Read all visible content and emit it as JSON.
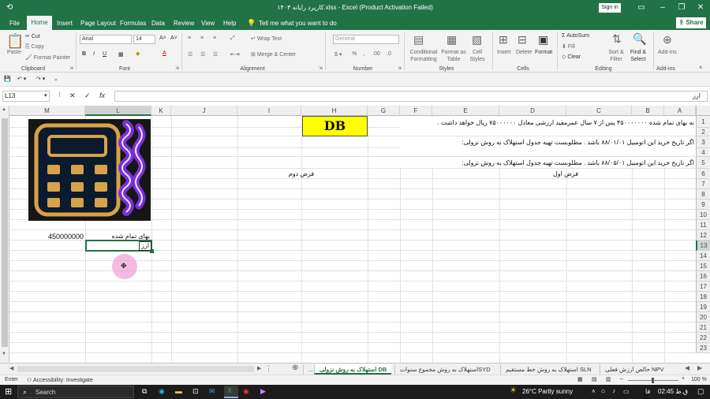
{
  "window": {
    "title": "کارپرد رایانه ۱۴۰۴.xlsx  -  Excel (Product Activation Failed)",
    "sign_in": "Sign in"
  },
  "ribbon_tabs": [
    "File",
    "Home",
    "Insert",
    "Page Layout",
    "Formulas",
    "Data",
    "Review",
    "View",
    "Help"
  ],
  "tell_me": "Tell me what you want to do",
  "share": "Share",
  "ribbon": {
    "clipboard": {
      "paste": "Paste",
      "cut": "Cut",
      "copy": "Copy",
      "format_painter": "Format Painter",
      "label": "Clipboard"
    },
    "font": {
      "name": "Arial",
      "size": "14",
      "label": "Font"
    },
    "alignment": {
      "wrap_text": "Wrap Text",
      "merge_center": "Merge & Center",
      "label": "Alignment"
    },
    "number": {
      "format": "General",
      "label": "Number"
    },
    "styles": {
      "conditional": "Conditional Formatting",
      "format_table": "Format as Table",
      "cell_styles": "Cell Styles",
      "label": "Styles"
    },
    "cells": {
      "insert": "Insert",
      "delete": "Delete",
      "format": "Format",
      "label": "Cells"
    },
    "editing": {
      "autosum": "AutoSum",
      "fill": "Fill",
      "clear": "Clear",
      "sort_filter": "Sort & Filter",
      "find_select": "Find & Select",
      "label": "Editing"
    },
    "addins": {
      "addins": "Add-ins",
      "label": "Add-ins"
    }
  },
  "formula_bar": {
    "name_box": "L13",
    "content": "ارز"
  },
  "columns": [
    "M",
    "L",
    "K",
    "J",
    "I",
    "H",
    "G",
    "F",
    "E",
    "D",
    "C",
    "B",
    "A"
  ],
  "rows": [
    "1",
    "2",
    "3",
    "4",
    "5",
    "6",
    "7",
    "8",
    "9",
    "10",
    "11",
    "12",
    "13",
    "14",
    "15",
    "16",
    "17",
    "18",
    "19",
    "20",
    "21",
    "22",
    "23"
  ],
  "cells": {
    "db_label": "DB",
    "row1": "به بهای تمام شده ۴۵۰۰۰۰۰۰۰ پس از ۷ سال عمرمفید ارزشی معادل ۷۵۰۰۰۰۰۰ ریال خواهد داشت .",
    "row3": "اگر تاریخ خرید این اتومبیل ۸۸/۰۱/۰۱ باشد . مطلوبست تهیه جدول استهلاک به روش نزولی:",
    "row5": "اگر تاریخ خرید این اتومبیل ۸۸/۰۵/۰۱ باشد . مطلوبست تهیه جدول استهلاک به روش نزولی:",
    "first_assumption": "فرض اول",
    "second_assumption": "فرض دوم",
    "cost_label": "بهای تمام شده",
    "cost_value": "450000000",
    "currency_label": "ارز"
  },
  "sheet_tabs": [
    "حالص ارزش فعلی NPV",
    "استهلاک به روش خط مستقیم SLN",
    "استهلاک به روش مجموع سنواتSYD",
    "استهلاک به روش نزولی DB",
    "..."
  ],
  "status": {
    "mode": "Enter",
    "accessibility": "Accessibility: Investigate",
    "zoom": "100 %"
  },
  "taskbar": {
    "search": "Search",
    "weather": "26°C  Partly sunny",
    "time": "ق.ظ 02:45",
    "lang": "فا"
  },
  "colors": {
    "excel_green": "#217346",
    "db_fill": "#ffff00",
    "logo_purple": "#7b2fd8"
  }
}
